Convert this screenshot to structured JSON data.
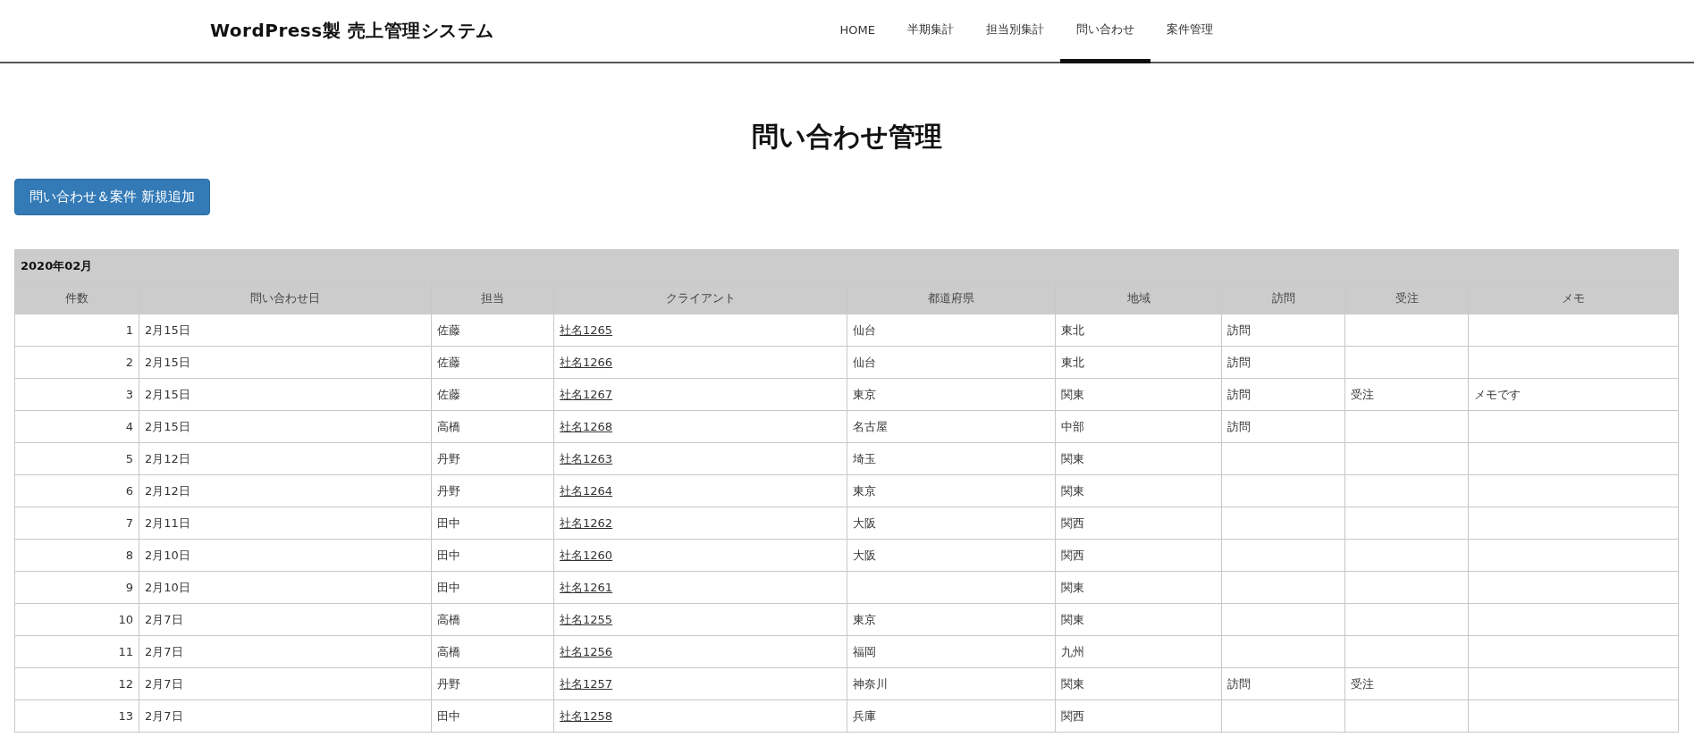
{
  "header": {
    "site_title": "WordPress製 売上管理システム",
    "nav": [
      {
        "label": "HOME",
        "selected": false
      },
      {
        "label": "半期集計",
        "selected": false
      },
      {
        "label": "担当別集計",
        "selected": false
      },
      {
        "label": "問い合わせ",
        "selected": true
      },
      {
        "label": "案件管理",
        "selected": false
      }
    ]
  },
  "page_title": "問い合わせ管理",
  "add_button": "問い合わせ＆案件 新規追加",
  "table": {
    "caption": "2020年02月",
    "columns": [
      "件数",
      "問い合わせ日",
      "担当",
      "クライアント",
      "都道府県",
      "地域",
      "訪問",
      "受注",
      "メモ"
    ],
    "rows": [
      [
        "1",
        "2月15日",
        "佐藤",
        "社名1265",
        "仙台",
        "東北",
        "訪問",
        "",
        ""
      ],
      [
        "2",
        "2月15日",
        "佐藤",
        "社名1266",
        "仙台",
        "東北",
        "訪問",
        "",
        ""
      ],
      [
        "3",
        "2月15日",
        "佐藤",
        "社名1267",
        "東京",
        "関東",
        "訪問",
        "受注",
        "メモです"
      ],
      [
        "4",
        "2月15日",
        "高橋",
        "社名1268",
        "名古屋",
        "中部",
        "訪問",
        "",
        ""
      ],
      [
        "5",
        "2月12日",
        "丹野",
        "社名1263",
        "埼玉",
        "関東",
        "",
        "",
        ""
      ],
      [
        "6",
        "2月12日",
        "丹野",
        "社名1264",
        "東京",
        "関東",
        "",
        "",
        ""
      ],
      [
        "7",
        "2月11日",
        "田中",
        "社名1262",
        "大阪",
        "関西",
        "",
        "",
        ""
      ],
      [
        "8",
        "2月10日",
        "田中",
        "社名1260",
        "大阪",
        "関西",
        "",
        "",
        ""
      ],
      [
        "9",
        "2月10日",
        "田中",
        "社名1261",
        "",
        "関東",
        "",
        "",
        ""
      ],
      [
        "10",
        "2月7日",
        "高橋",
        "社名1255",
        "東京",
        "関東",
        "",
        "",
        ""
      ],
      [
        "11",
        "2月7日",
        "高橋",
        "社名1256",
        "福岡",
        "九州",
        "",
        "",
        ""
      ],
      [
        "12",
        "2月7日",
        "丹野",
        "社名1257",
        "神奈川",
        "関東",
        "訪問",
        "受注",
        ""
      ],
      [
        "13",
        "2月7日",
        "田中",
        "社名1258",
        "兵庫",
        "関西",
        "",
        "",
        ""
      ]
    ]
  }
}
